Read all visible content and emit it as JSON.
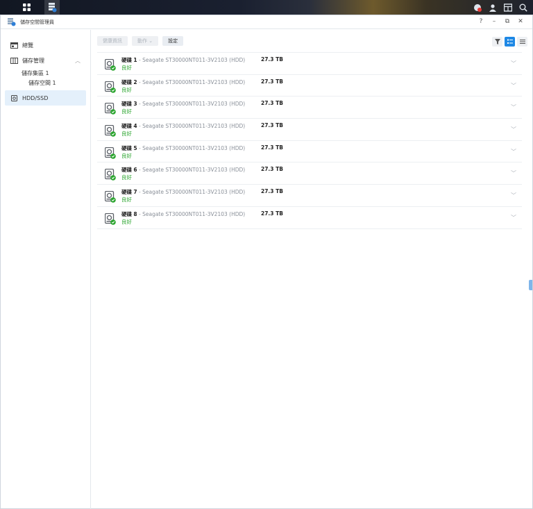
{
  "window": {
    "title": "儲存空間管理員"
  },
  "window_controls": {
    "help": "?",
    "minimize": "–",
    "restore": "⧉",
    "close": "✕"
  },
  "sidebar": {
    "items": [
      {
        "label": "總覽"
      },
      {
        "label": "儲存管理",
        "expanded": true
      },
      {
        "label": "儲存集區 1"
      },
      {
        "label": "儲存空間 1"
      },
      {
        "label": "HDD/SSD",
        "active": true
      }
    ]
  },
  "toolbar": {
    "health_info": "健康資訊",
    "action": "動作 ⌄",
    "settings": "設定"
  },
  "disks": [
    {
      "label": "硬碟",
      "num": "1",
      "model": "Seagate ST30000NT011-3V2103 (HDD)",
      "status": "良好",
      "size": "27.3 TB"
    },
    {
      "label": "硬碟",
      "num": "2",
      "model": "Seagate ST30000NT011-3V2103 (HDD)",
      "status": "良好",
      "size": "27.3 TB"
    },
    {
      "label": "硬碟",
      "num": "3",
      "model": "Seagate ST30000NT011-3V2103 (HDD)",
      "status": "良好",
      "size": "27.3 TB"
    },
    {
      "label": "硬碟",
      "num": "4",
      "model": "Seagate ST30000NT011-3V2103 (HDD)",
      "status": "良好",
      "size": "27.3 TB"
    },
    {
      "label": "硬碟",
      "num": "5",
      "model": "Seagate ST30000NT011-3V2103 (HDD)",
      "status": "良好",
      "size": "27.3 TB"
    },
    {
      "label": "硬碟",
      "num": "6",
      "model": "Seagate ST30000NT011-3V2103 (HDD)",
      "status": "良好",
      "size": "27.3 TB"
    },
    {
      "label": "硬碟",
      "num": "7",
      "model": "Seagate ST30000NT011-3V2103 (HDD)",
      "status": "良好",
      "size": "27.3 TB"
    },
    {
      "label": "硬碟",
      "num": "8",
      "model": "Seagate ST30000NT011-3V2103 (HDD)",
      "status": "良好",
      "size": "27.3 TB"
    }
  ],
  "colors": {
    "accent": "#1e88e5",
    "status_ok": "#2aa52e",
    "active_nav_bg": "#e4f0fb"
  }
}
